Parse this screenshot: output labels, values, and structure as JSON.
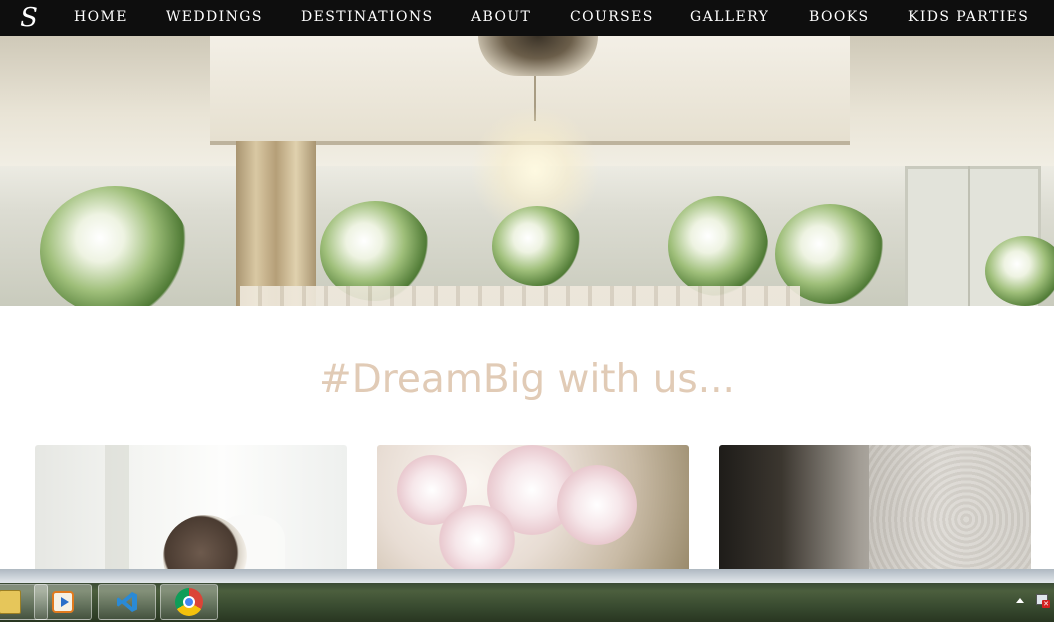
{
  "nav": {
    "logo": "S",
    "items": [
      "HOME",
      "WEDDINGS",
      "DESTINATIONS",
      "ABOUT",
      "COURSES",
      "GALLERY",
      "BOOKS",
      "KIDS PARTIES"
    ]
  },
  "main": {
    "heading": "#DreamBig with us..."
  },
  "taskbar": {
    "apps": [
      "folder-icon",
      "media-player-icon",
      "vscode-icon",
      "chrome-icon"
    ]
  },
  "colors": {
    "nav_bg": "#0e0e0e",
    "heading": "#e1cbb6"
  }
}
